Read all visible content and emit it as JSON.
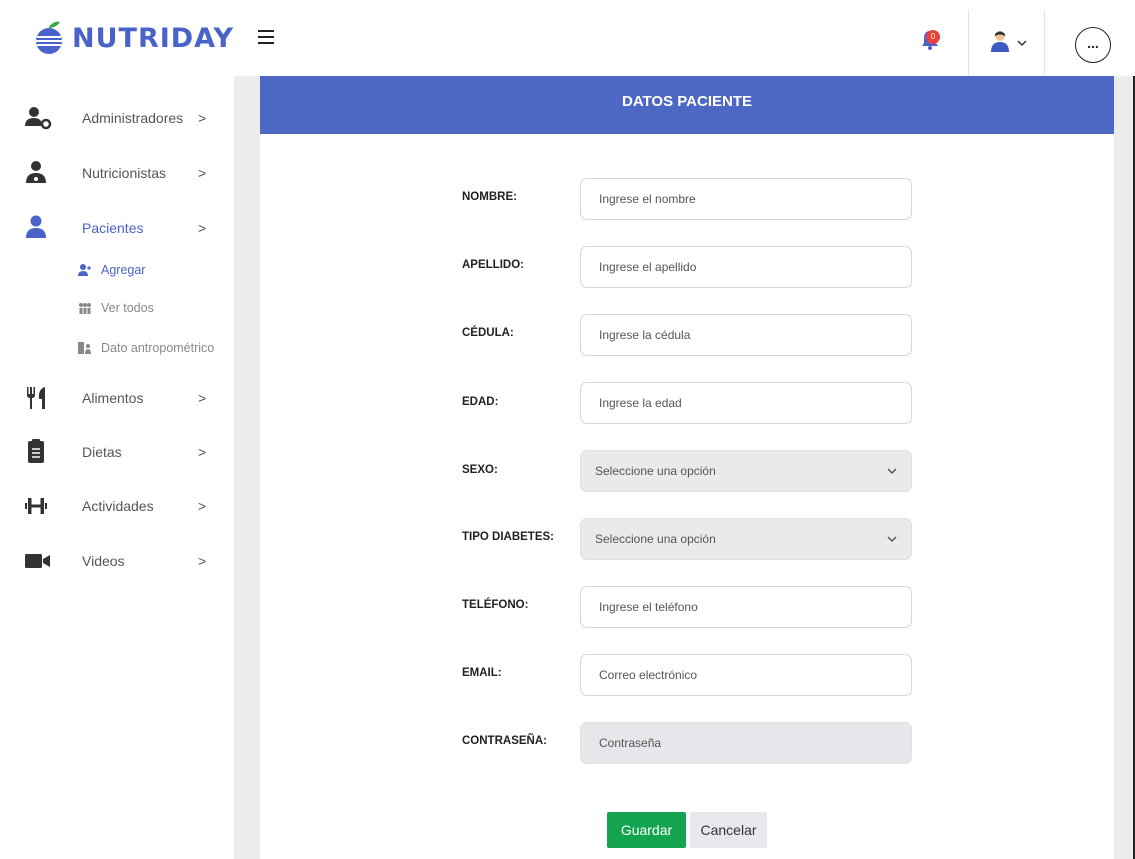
{
  "brand": {
    "name": "NUTRIDAY",
    "color": "#4a63c9",
    "icon": "apple-icon"
  },
  "header": {
    "menu_icon": "hamburger-icon",
    "notifications": {
      "icon": "bell-icon",
      "count": "0"
    },
    "user_icon": "user-avatar-icon",
    "more_label": "..."
  },
  "sidebar": {
    "items": [
      {
        "label": "Administradores",
        "icon": "user-gear-icon"
      },
      {
        "label": "Nutricionistas",
        "icon": "user-doctor-icon"
      },
      {
        "label": "Pacientes",
        "icon": "user-icon",
        "active": true
      },
      {
        "label": "Alimentos",
        "icon": "utensils-icon"
      },
      {
        "label": "Dietas",
        "icon": "clipboard-list-icon"
      },
      {
        "label": "Actividades",
        "icon": "dumbbell-icon"
      },
      {
        "label": "Videos",
        "icon": "video-icon"
      }
    ],
    "subitems": [
      {
        "label": "Agregar",
        "icon": "user-plus-icon",
        "active": true
      },
      {
        "label": "Ver todos",
        "icon": "users-icon"
      },
      {
        "label": "Dato antropométrico",
        "icon": "scale-icon"
      }
    ],
    "chevron": ">"
  },
  "form": {
    "title": "DATOS PACIENTE",
    "fields": [
      {
        "label": "NOMBRE:",
        "placeholder": "Ingrese el nombre",
        "type": "input"
      },
      {
        "label": "APELLIDO:",
        "placeholder": "Ingrese el apellido",
        "type": "input"
      },
      {
        "label": "CÉDULA:",
        "placeholder": "Ingrese la cédula",
        "type": "input"
      },
      {
        "label": "EDAD:",
        "placeholder": "Ingrese la edad",
        "type": "input"
      },
      {
        "label": "SEXO:",
        "value": "Seleccione una opción",
        "type": "select"
      },
      {
        "label": "TIPO DIABETES:",
        "value": "Seleccione una opción",
        "type": "select"
      },
      {
        "label": "TELÉFONO:",
        "placeholder": "Ingrese el teléfono",
        "type": "input"
      },
      {
        "label": "EMAIL:",
        "placeholder": "Correo electrónico",
        "type": "input"
      },
      {
        "label": "CONTRASEÑA:",
        "placeholder": "Contraseña",
        "type": "password"
      }
    ],
    "save_label": "Guardar",
    "cancel_label": "Cancelar"
  },
  "colors": {
    "primary": "#4d68c4",
    "save": "#14a34f",
    "badge": "#e8433b"
  }
}
